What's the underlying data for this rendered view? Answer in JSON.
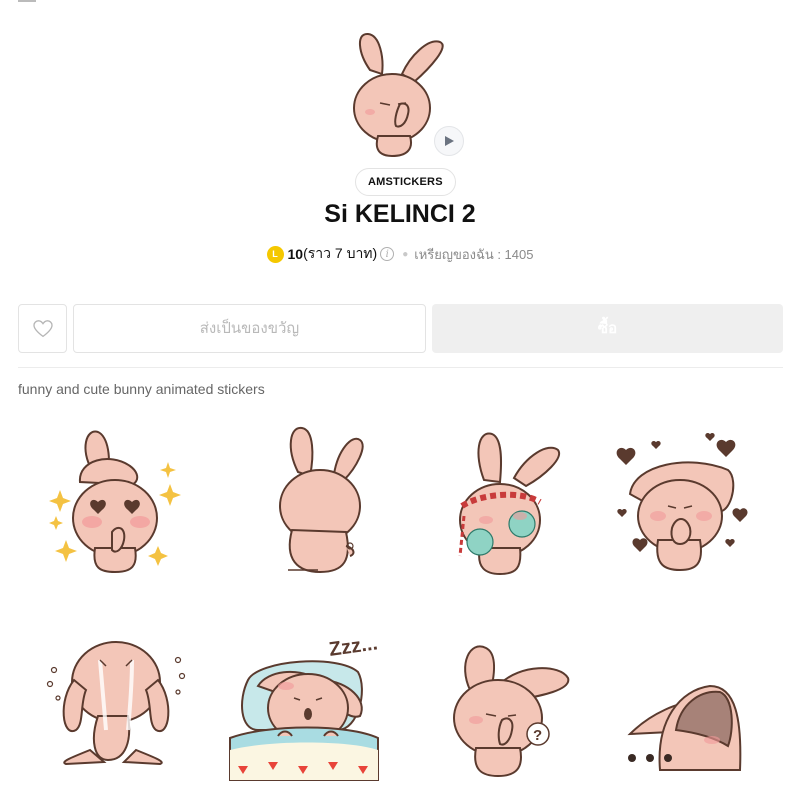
{
  "hero": {
    "icon": "bunny-shush-sticker",
    "play_icon": "play-icon"
  },
  "author": {
    "label": "AMSTICKERS"
  },
  "title": "Si KELINCI 2",
  "price": {
    "coin_icon": "line-coin-icon",
    "coin_letter": "L",
    "amount": "10",
    "approx": "(ราว 7 บาท)",
    "info_icon": "info-icon",
    "my_coins": "เหรียญของฉัน : 1405"
  },
  "actions": {
    "like_icon": "heart-icon",
    "gift_label": "ส่งเป็นของขวัญ",
    "buy_label": "ซื้อ"
  },
  "description": "funny and cute bunny animated stickers",
  "colors": {
    "bunny_fill": "#f3c6b8",
    "bunny_outline": "#5a3a2e",
    "coin": "#f5c800",
    "buy_bg": "#efefef"
  },
  "stickers": [
    {
      "name": "heart-eyes-sparkle"
    },
    {
      "name": "back-view"
    },
    {
      "name": "cheerleader-headband"
    },
    {
      "name": "hearts-hands-clasped"
    },
    {
      "name": "crying-ears-down"
    },
    {
      "name": "sleeping-zzz"
    },
    {
      "name": "shush-question"
    },
    {
      "name": "peeking-dots"
    }
  ],
  "sticker_text": {
    "zzz": "Zzz...",
    "question": "?"
  }
}
